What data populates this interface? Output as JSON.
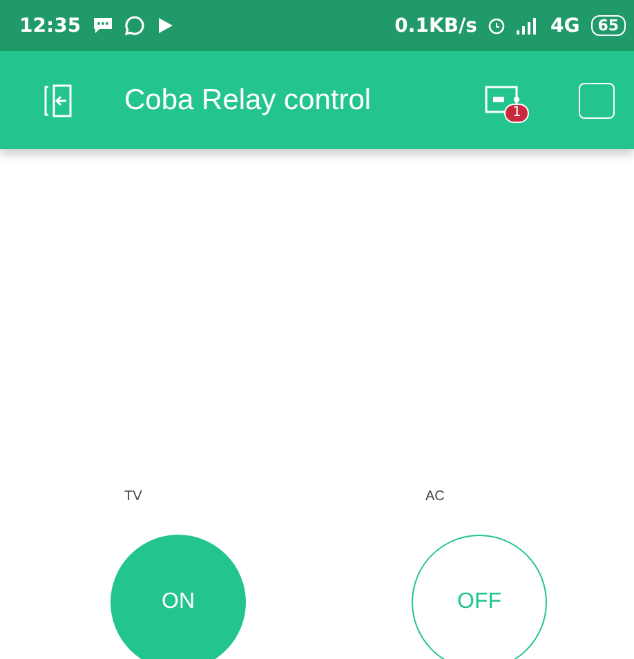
{
  "status_bar": {
    "time": "12:35",
    "speed": "0.1KB/s",
    "network": "4G",
    "battery": "65"
  },
  "app_bar": {
    "title": "Coba Relay control",
    "badge": "1"
  },
  "buttons": [
    {
      "label": "TV",
      "text": "ON",
      "on": true
    },
    {
      "label": "AC",
      "text": "OFF",
      "on": false
    }
  ]
}
